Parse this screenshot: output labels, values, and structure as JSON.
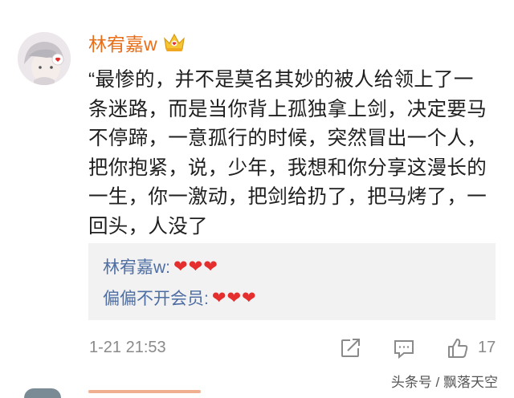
{
  "comment": {
    "username": "林宥嘉w",
    "body": "“最惨的，并不是莫名其妙的被人给领上了一条迷路，而是当你背上孤独拿上剑，决定要马不停蹄，一意孤行的时候，突然冒出一个人，把你抱紧，说，少年，我想和你分享这漫长的一生，你一激动，把剑给扔了，把马烤了，一回头，人没了",
    "timestamp": "1-21 21:53",
    "like_count": "17",
    "badge_icon": "vip-crown-icon",
    "colors": {
      "username": "#e76f1a",
      "reply_author": "#4e6ea3",
      "heart": "#e52e2e"
    }
  },
  "replies": [
    {
      "author": "林宥嘉w:",
      "text": "❤❤❤"
    },
    {
      "author": "偏偏不开会员:",
      "text": "❤❤❤"
    }
  ],
  "actions": [
    "share-icon",
    "comment-icon",
    "like-icon"
  ],
  "watermark": "头条号 / 飘落天空"
}
